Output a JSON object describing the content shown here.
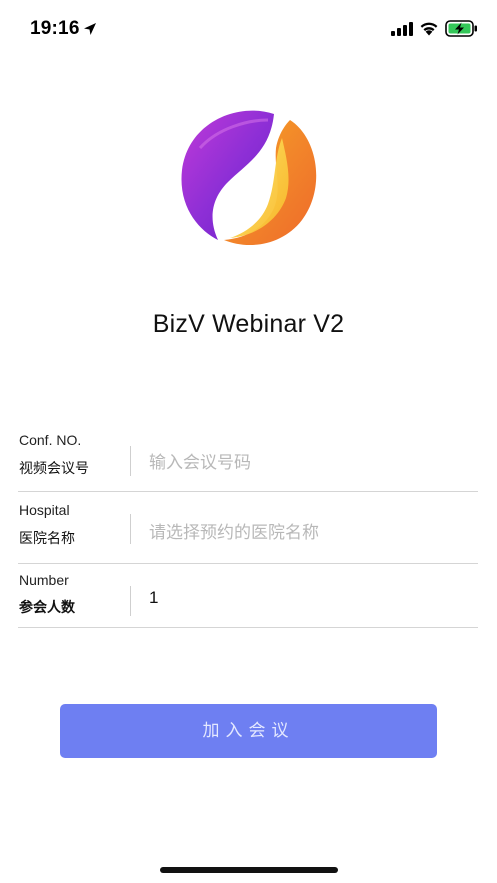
{
  "status_bar": {
    "time": "19:16",
    "icons": [
      "location-arrow-icon",
      "cellular-signal-icon",
      "wifi-icon",
      "battery-charging-icon"
    ],
    "battery_color": "#34c759"
  },
  "app": {
    "logo": "bizv-logo",
    "title": "BizV Webinar V2"
  },
  "form": {
    "conf": {
      "label_en": "Conf. NO.",
      "label_cn": "视频会议号",
      "value": "",
      "placeholder": "输入会议号码"
    },
    "hospital": {
      "label_en": "Hospital",
      "label_cn": "医院名称",
      "value": "",
      "placeholder": "请选择预约的医院名称"
    },
    "number": {
      "label_en": "Number",
      "label_cn": "参会人数",
      "value": "1",
      "placeholder": ""
    }
  },
  "join_button": {
    "label": "加入会议",
    "color": "#6e7ff2"
  }
}
